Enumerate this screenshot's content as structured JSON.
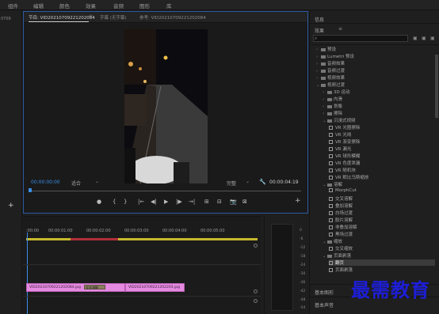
{
  "menu": [
    "组件",
    "编辑",
    "颜色",
    "效果",
    "音频",
    "图形",
    "库"
  ],
  "left_strip": {
    "timecode": "0709"
  },
  "program": {
    "tabs": [
      "节目: VID20210709221202084",
      "字幕 (无字幕)",
      "参考: VID20210709221202084"
    ],
    "timecode_left": "00:00:00:00",
    "fit": "适合",
    "quality": "完整",
    "timecode_right": "00:00:04:19",
    "controls": [
      "●",
      "{",
      "}",
      "|←",
      "◀|",
      "▶",
      "|▶",
      "→|",
      "⊞",
      "⊟",
      "📷",
      "⊠",
      "+"
    ]
  },
  "timeline": {
    "ruler": [
      ":00:00",
      "00:00:01:00",
      "00:00:02:00",
      "00:00:03:00",
      "00:00:04:00",
      "00:00:05:00"
    ],
    "clip_a": "VID20210709221202084.jpg",
    "transition": "交叉溶解",
    "clip_b": "VID20210709221202203.jpg"
  },
  "meter": [
    "0",
    "-6",
    "-12",
    "-18",
    "-24",
    "-30",
    "-36",
    "-42",
    "-48",
    "-54"
  ],
  "effects_panel": {
    "info_title": "信息",
    "title": "效果",
    "items": [
      {
        "level": 0,
        "type": "folder",
        "label": "预设"
      },
      {
        "level": 0,
        "type": "folder",
        "label": "Lumetri 预设"
      },
      {
        "level": 0,
        "type": "folder",
        "label": "音频效果"
      },
      {
        "level": 0,
        "type": "folder",
        "label": "音频过渡"
      },
      {
        "level": 0,
        "type": "folder",
        "label": "视频效果"
      },
      {
        "level": 0,
        "type": "folder",
        "label": "视频过渡",
        "open": true
      },
      {
        "level": 1,
        "type": "folder",
        "label": "3D 运动"
      },
      {
        "level": 1,
        "type": "folder",
        "label": "内滑"
      },
      {
        "level": 1,
        "type": "folder",
        "label": "划像"
      },
      {
        "level": 1,
        "type": "folder",
        "label": "擦除"
      },
      {
        "level": 1,
        "type": "folder",
        "label": "沉浸式视频",
        "open": true
      },
      {
        "level": 2,
        "type": "fx",
        "label": "VR 光圈擦除"
      },
      {
        "level": 2,
        "type": "fx",
        "label": "VR 光线"
      },
      {
        "level": 2,
        "type": "fx",
        "label": "VR 渐变擦除"
      },
      {
        "level": 2,
        "type": "fx",
        "label": "VR 漏光"
      },
      {
        "level": 2,
        "type": "fx",
        "label": "VR 球形模糊"
      },
      {
        "level": 2,
        "type": "fx",
        "label": "VR 色度泄漏"
      },
      {
        "level": 2,
        "type": "fx",
        "label": "VR 随机块"
      },
      {
        "level": 2,
        "type": "fx",
        "label": "VR 默比乌斯缩放"
      },
      {
        "level": 1,
        "type": "folder",
        "label": "溶解",
        "open": true
      },
      {
        "level": 2,
        "type": "fx",
        "label": "MorphCut"
      },
      {
        "level": 2,
        "type": "fx",
        "label": "交叉溶解"
      },
      {
        "level": 2,
        "type": "fx",
        "label": "叠加溶解"
      },
      {
        "level": 2,
        "type": "fx",
        "label": "白场过渡"
      },
      {
        "level": 2,
        "type": "fx",
        "label": "胶片溶解"
      },
      {
        "level": 2,
        "type": "fx",
        "label": "非叠加溶解"
      },
      {
        "level": 2,
        "type": "fx",
        "label": "黑场过渡"
      },
      {
        "level": 1,
        "type": "folder",
        "label": "缩放",
        "open": true
      },
      {
        "level": 2,
        "type": "fx",
        "label": "交叉缩放"
      },
      {
        "level": 1,
        "type": "folder",
        "label": "页面剥落",
        "open": true
      },
      {
        "level": 2,
        "type": "fx",
        "label": "翻页",
        "selected": true
      },
      {
        "level": 2,
        "type": "fx",
        "label": "页面剥落"
      }
    ],
    "bottom_items": [
      "基本图形",
      "基本声音"
    ]
  },
  "watermark": "最需教育"
}
